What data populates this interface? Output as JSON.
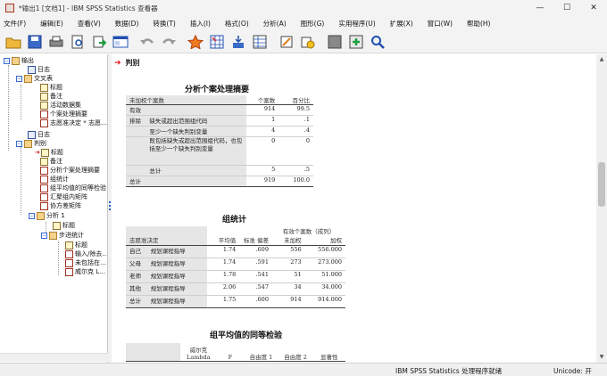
{
  "window": {
    "title": "*输出1 [文档1] - IBM SPSS Statistics 查看器",
    "minimize": "—",
    "maximize": "☐",
    "close": "✕"
  },
  "menu": [
    "文件(F)",
    "编辑(E)",
    "查看(V)",
    "数据(D)",
    "转换(T)",
    "插入(I)",
    "格式(O)",
    "分析(A)",
    "图形(G)",
    "实用程序(U)",
    "扩展(X)",
    "窗口(W)",
    "帮助(H)"
  ],
  "toolbar": {
    "icons": [
      "open-icon",
      "save-icon",
      "print-icon",
      "print-preview-icon",
      "export-icon",
      "recall-dialog-icon",
      "undo-icon",
      "redo-icon",
      "goto-data-icon",
      "goto-case-icon",
      "goto-variable-icon",
      "variables-icon",
      "designate-window-icon",
      "select-cases-icon",
      "show-all-icon",
      "insert-output-icon",
      "search-icon"
    ]
  },
  "outline": {
    "nodes": [
      {
        "label": "输出",
        "level": 0
      },
      {
        "label": "日志",
        "level": 1
      },
      {
        "label": "交叉表",
        "level": 1
      },
      {
        "label": "标题",
        "level": 2
      },
      {
        "label": "备注",
        "level": 2
      },
      {
        "label": "活动数据集",
        "level": 2
      },
      {
        "label": "个案处理摘要",
        "level": 2
      },
      {
        "label": "志愿准决定 * 志愿…",
        "level": 2
      },
      {
        "label": "日志",
        "level": 1
      },
      {
        "label": "判别",
        "level": 1
      },
      {
        "label": "标题",
        "level": 2
      },
      {
        "label": "备注",
        "level": 2
      },
      {
        "label": "分析个案处理摘要",
        "level": 2
      },
      {
        "label": "组统计",
        "level": 2
      },
      {
        "label": "组平均值的同等检验",
        "level": 2
      },
      {
        "label": "汇聚组内矩阵",
        "level": 2
      },
      {
        "label": "协方差矩阵",
        "level": 2
      },
      {
        "label": "分析 1",
        "level": 2
      },
      {
        "label": "标题",
        "level": 3
      },
      {
        "label": "步进统计",
        "level": 3
      },
      {
        "label": "标题",
        "level": 4
      },
      {
        "label": "输入/除去…",
        "level": 4
      },
      {
        "label": "未包括在…",
        "level": 4
      },
      {
        "label": "威尔克 L…",
        "level": 4
      }
    ]
  },
  "content": {
    "section_title": "判别"
  },
  "summary_table": {
    "title": "分析个案处理摘要",
    "col_headers": [
      "未加权个案数",
      "个案数",
      "百分比"
    ],
    "rows": [
      {
        "a": "有效",
        "b": "",
        "n": "914",
        "p": "99.5"
      },
      {
        "a": "排除",
        "b": "缺失或超出范围组代码",
        "n": "1",
        "p": ".1"
      },
      {
        "a": "",
        "b": "至少一个缺失判别变量",
        "n": "4",
        "p": ".4"
      },
      {
        "a": "",
        "b": "既包括缺失或超出范围组代码，也包括至少一个缺失判别变量",
        "n": "0",
        "p": "0"
      },
      {
        "a": "",
        "b": "总计",
        "n": "5",
        "p": ".5"
      },
      {
        "a": "总计",
        "b": "",
        "n": "919",
        "p": "100.0"
      }
    ]
  },
  "group_table": {
    "title": "组统计",
    "span_header": "有效个案数（成列）",
    "col_headers": [
      "志愿准决定",
      "平均值",
      "标准 偏差",
      "未加权",
      "加权"
    ],
    "rows": [
      {
        "a": "自己",
        "b": "规划课程指导",
        "m": "1.74",
        "sd": ".609",
        "u": "556",
        "w": "556.000"
      },
      {
        "a": "父母",
        "b": "规划课程指导",
        "m": "1.74",
        "sd": ".591",
        "u": "273",
        "w": "273.000"
      },
      {
        "a": "老师",
        "b": "规划课程指导",
        "m": "1.78",
        "sd": ".541",
        "u": "51",
        "w": "51.000"
      },
      {
        "a": "其他",
        "b": "规划课程指导",
        "m": "2.06",
        "sd": ".547",
        "u": "34",
        "w": "34.000"
      },
      {
        "a": "总计",
        "b": "规划课程指导",
        "m": "1.75",
        "sd": ".600",
        "u": "914",
        "w": "914.000"
      }
    ]
  },
  "equality_table": {
    "title": "组平均值的同等检验",
    "col_headers": [
      "威尔克 Lambda",
      "F",
      "自由度 1",
      "自由度 2",
      "显著性"
    ]
  },
  "status": {
    "processor": "IBM SPSS Statistics 处理程序就绪",
    "unicode": "Unicode: 开"
  }
}
